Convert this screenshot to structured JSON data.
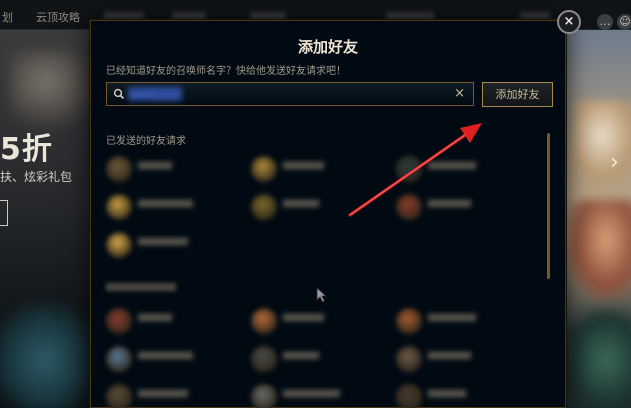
{
  "background": {
    "nav_items": [
      "划",
      "云顶攻略",
      "",
      "",
      "",
      "",
      ""
    ],
    "promo_big": "5折",
    "promo_sub": "扶、炫彩礼包"
  },
  "modal": {
    "title": "添加好友",
    "hint": "已经知道好友的召唤师名字？快给他发送好友请求吧！",
    "search": {
      "value": "------",
      "placeholder": ""
    },
    "add_button_label": "添加好友",
    "sent_section_label": "已发送的好友请求",
    "received_section_label": "",
    "sent_requests": [
      {
        "name": "",
        "avatar_color": "#6b5a3a"
      },
      {
        "name": "",
        "avatar_color": "#b08a3a"
      },
      {
        "name": "",
        "avatar_color": "#2a3a3e"
      },
      {
        "name": "",
        "avatar_color": "#c9a040"
      },
      {
        "name": "",
        "avatar_color": "#7a6a2a"
      },
      {
        "name": "",
        "avatar_color": "#8a3a2a"
      },
      {
        "name": "",
        "avatar_color": "#d8a848"
      }
    ],
    "other_requests": [
      {
        "name": "",
        "avatar_color": "#8a3a30"
      },
      {
        "name": "",
        "avatar_color": "#b86a3a"
      },
      {
        "name": "",
        "avatar_color": "#a85a30"
      },
      {
        "name": "",
        "avatar_color": "#5a7a9a"
      },
      {
        "name": "",
        "avatar_color": "#4a4a4a"
      },
      {
        "name": "",
        "avatar_color": "#6a5a4a"
      },
      {
        "name": "",
        "avatar_color": "#5a4a3a"
      },
      {
        "name": "",
        "avatar_color": "#6a6a6a"
      },
      {
        "name": "",
        "avatar_color": "#4a3a30"
      }
    ]
  },
  "icons": {
    "close": "×",
    "clear": "×",
    "search": "search-icon"
  },
  "colors": {
    "modal_bg": "#010a13",
    "gold_border": "#785a28",
    "gold_text": "#cdbe91",
    "arrow_red": "#e02020"
  }
}
